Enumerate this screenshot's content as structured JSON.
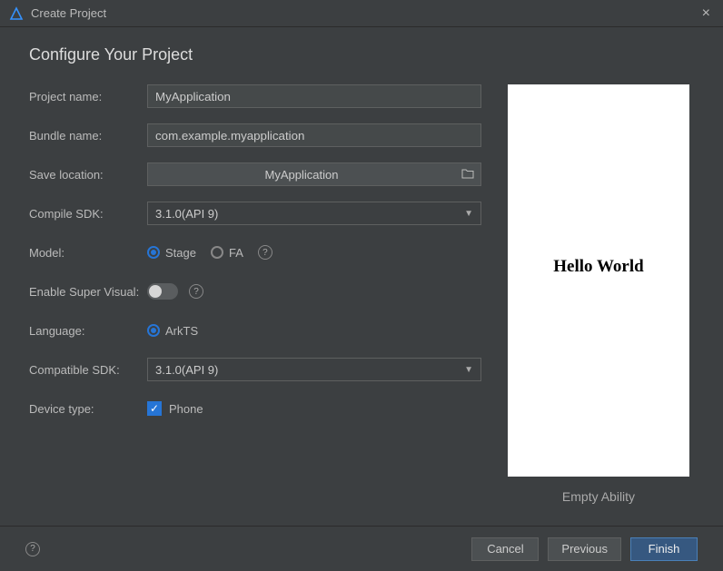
{
  "window": {
    "title": "Create Project"
  },
  "heading": "Configure Your Project",
  "labels": {
    "project_name": "Project name:",
    "bundle_name": "Bundle name:",
    "save_location": "Save location:",
    "compile_sdk": "Compile SDK:",
    "model": "Model:",
    "enable_super_visual": "Enable Super Visual:",
    "language": "Language:",
    "compatible_sdk": "Compatible SDK:",
    "device_type": "Device type:"
  },
  "values": {
    "project_name": "MyApplication",
    "bundle_name": "com.example.myapplication",
    "save_location": "MyApplication",
    "compile_sdk": "3.1.0(API 9)",
    "model_stage": "Stage",
    "model_fa": "FA",
    "language_arkts": "ArkTS",
    "compatible_sdk": "3.1.0(API 9)",
    "device_phone": "Phone"
  },
  "state": {
    "model_selected": "Stage",
    "enable_super_visual": false,
    "language_selected": "ArkTS",
    "device_phone_checked": true
  },
  "preview": {
    "text": "Hello World",
    "caption": "Empty Ability"
  },
  "buttons": {
    "cancel": "Cancel",
    "previous": "Previous",
    "finish": "Finish"
  }
}
